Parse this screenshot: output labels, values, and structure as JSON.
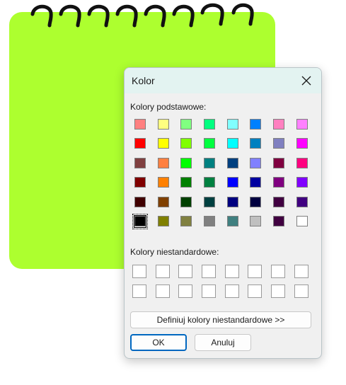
{
  "colors": {
    "notebook": "#adff2f",
    "ring": "#111111",
    "accent": "#0067c0",
    "titlebar": "#e3f3f1"
  },
  "dialog": {
    "title": "Kolor",
    "close_icon": "close-icon",
    "basic_label": "Kolory podstawowe:",
    "custom_label": "Kolory niestandardowe:",
    "define_button": "Definiuj kolory niestandardowe >>",
    "ok_button": "OK",
    "cancel_button": "Anuluj"
  },
  "basic_colors": [
    [
      "#ff8080",
      "#ffff80",
      "#80ff80",
      "#00ff80",
      "#80ffff",
      "#0080ff",
      "#ff80c0",
      "#ff80ff"
    ],
    [
      "#ff0000",
      "#ffff00",
      "#80ff00",
      "#00ff40",
      "#00ffff",
      "#0080c0",
      "#8080c0",
      "#ff00ff"
    ],
    [
      "#804040",
      "#ff8040",
      "#00ff00",
      "#008080",
      "#004080",
      "#8080ff",
      "#800040",
      "#ff0080"
    ],
    [
      "#800000",
      "#ff8000",
      "#008000",
      "#008040",
      "#0000ff",
      "#0000a0",
      "#800080",
      "#8000ff"
    ],
    [
      "#400000",
      "#804000",
      "#004000",
      "#004040",
      "#000080",
      "#000040",
      "#400040",
      "#400080"
    ],
    [
      "#000000",
      "#808000",
      "#808040",
      "#808080",
      "#408080",
      "#c0c0c0",
      "#400040",
      "#ffffff"
    ]
  ],
  "selected_color": "#000000",
  "custom_colors": [
    [
      "#ffffff",
      "#ffffff",
      "#ffffff",
      "#ffffff",
      "#ffffff",
      "#ffffff",
      "#ffffff",
      "#ffffff"
    ],
    [
      "#ffffff",
      "#ffffff",
      "#ffffff",
      "#ffffff",
      "#ffffff",
      "#ffffff",
      "#ffffff",
      "#ffffff"
    ]
  ]
}
